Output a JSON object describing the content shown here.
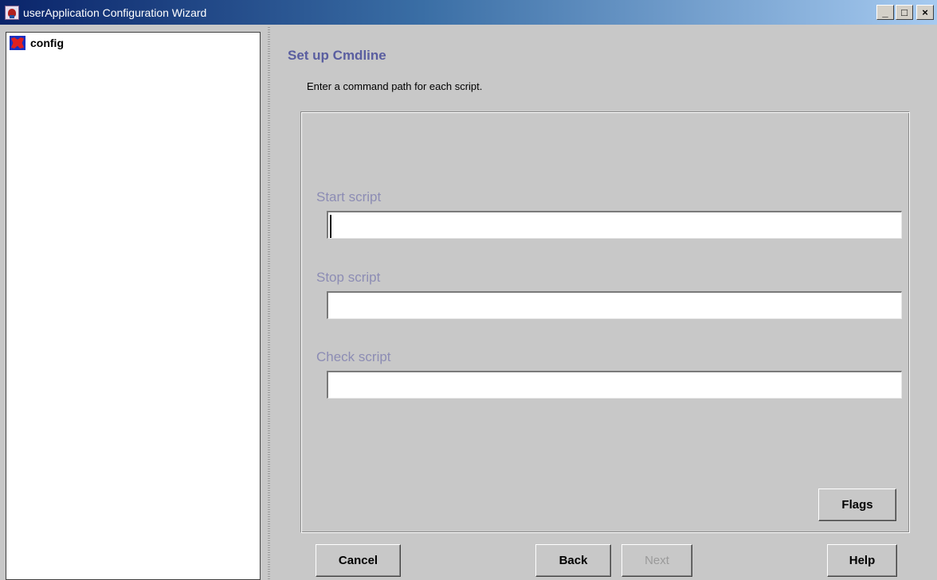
{
  "window": {
    "title": "userApplication Configuration Wizard",
    "minimize": "_",
    "maximize": "□",
    "close": "×"
  },
  "tree": {
    "root_label": "config"
  },
  "main": {
    "title": "Set up Cmdline",
    "instruction": "Enter a command path for each script.",
    "fields": {
      "start": {
        "label": "Start script",
        "value": ""
      },
      "stop": {
        "label": "Stop script",
        "value": ""
      },
      "check": {
        "label": "Check script",
        "value": ""
      }
    },
    "flags_label": "Flags"
  },
  "footer": {
    "cancel_label": "Cancel",
    "back_label": "Back",
    "next_label": "Next",
    "help_label": "Help"
  },
  "colors": {
    "title_accent": "#5a5ea0",
    "field_label": "#8c8cb4",
    "panel_bg": "#c8c8c8"
  }
}
